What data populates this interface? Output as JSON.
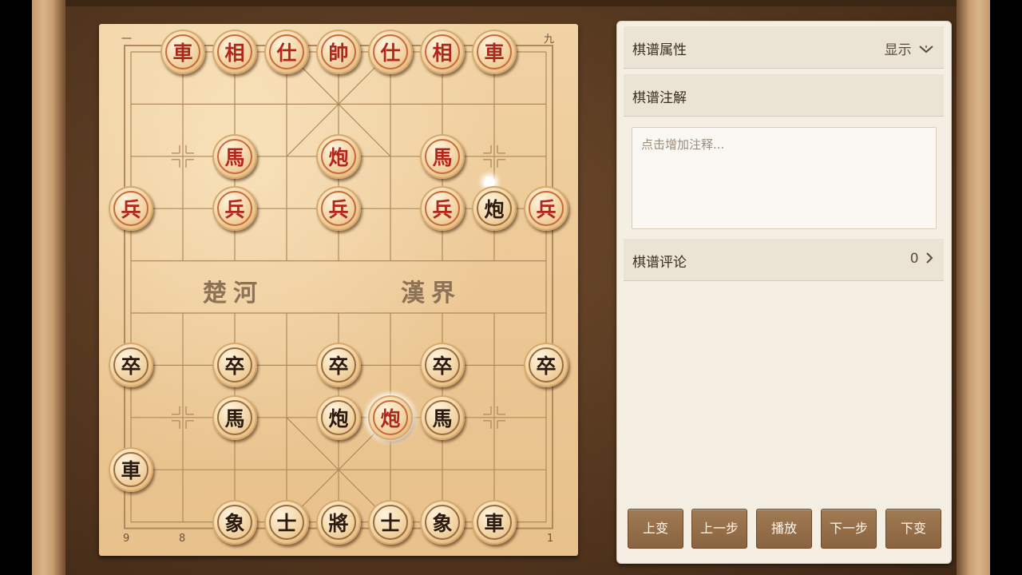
{
  "board": {
    "top_coords": [
      "一",
      "九"
    ],
    "bottom_coords": [
      "9",
      "8",
      "1"
    ],
    "river_left": "楚河",
    "river_right": "漢界"
  },
  "pieces": [
    {
      "id": "r-chariot-1",
      "side": "red",
      "char": "車",
      "col": 1,
      "row": 0
    },
    {
      "id": "r-elephant-1",
      "side": "red",
      "char": "相",
      "col": 2,
      "row": 0
    },
    {
      "id": "r-advisor-1",
      "side": "red",
      "char": "仕",
      "col": 3,
      "row": 0
    },
    {
      "id": "r-general",
      "side": "red",
      "char": "帥",
      "col": 4,
      "row": 0
    },
    {
      "id": "r-advisor-2",
      "side": "red",
      "char": "仕",
      "col": 5,
      "row": 0
    },
    {
      "id": "r-elephant-2",
      "side": "red",
      "char": "相",
      "col": 6,
      "row": 0
    },
    {
      "id": "r-chariot-2",
      "side": "red",
      "char": "車",
      "col": 7,
      "row": 0
    },
    {
      "id": "r-horse-1",
      "side": "red",
      "char": "馬",
      "col": 2,
      "row": 2
    },
    {
      "id": "r-cannon-1",
      "side": "red",
      "char": "炮",
      "col": 4,
      "row": 2
    },
    {
      "id": "r-horse-2",
      "side": "red",
      "char": "馬",
      "col": 6,
      "row": 2
    },
    {
      "id": "r-soldier-1",
      "side": "red",
      "char": "兵",
      "col": 0,
      "row": 3
    },
    {
      "id": "r-soldier-2",
      "side": "red",
      "char": "兵",
      "col": 2,
      "row": 3
    },
    {
      "id": "r-soldier-3",
      "side": "red",
      "char": "兵",
      "col": 4,
      "row": 3
    },
    {
      "id": "r-soldier-4",
      "side": "red",
      "char": "兵",
      "col": 6,
      "row": 3
    },
    {
      "id": "b-cannon-1",
      "side": "black",
      "char": "炮",
      "col": 7,
      "row": 3
    },
    {
      "id": "r-soldier-5",
      "side": "red",
      "char": "兵",
      "col": 8,
      "row": 3
    },
    {
      "id": "b-pawn-1",
      "side": "black",
      "char": "卒",
      "col": 0,
      "row": 6
    },
    {
      "id": "b-pawn-2",
      "side": "black",
      "char": "卒",
      "col": 2,
      "row": 6
    },
    {
      "id": "b-pawn-3",
      "side": "black",
      "char": "卒",
      "col": 4,
      "row": 6
    },
    {
      "id": "b-pawn-4",
      "side": "black",
      "char": "卒",
      "col": 6,
      "row": 6
    },
    {
      "id": "b-pawn-5",
      "side": "black",
      "char": "卒",
      "col": 8,
      "row": 6
    },
    {
      "id": "b-horse-1",
      "side": "black",
      "char": "馬",
      "col": 2,
      "row": 7
    },
    {
      "id": "b-cannon-2",
      "side": "black",
      "char": "炮",
      "col": 4,
      "row": 7
    },
    {
      "id": "r-cannon-2",
      "side": "red",
      "char": "炮",
      "col": 5,
      "row": 7,
      "selected": true
    },
    {
      "id": "b-horse-2",
      "side": "black",
      "char": "馬",
      "col": 6,
      "row": 7
    },
    {
      "id": "b-chariot-1",
      "side": "black",
      "char": "車",
      "col": 0,
      "row": 8
    },
    {
      "id": "b-elephant-1",
      "side": "black",
      "char": "象",
      "col": 2,
      "row": 9
    },
    {
      "id": "b-advisor-1",
      "side": "black",
      "char": "士",
      "col": 3,
      "row": 9
    },
    {
      "id": "b-general",
      "side": "black",
      "char": "將",
      "col": 4,
      "row": 9
    },
    {
      "id": "b-advisor-2",
      "side": "black",
      "char": "士",
      "col": 5,
      "row": 9
    },
    {
      "id": "b-elephant-2",
      "side": "black",
      "char": "象",
      "col": 6,
      "row": 9
    },
    {
      "id": "b-chariot-2",
      "side": "black",
      "char": "車",
      "col": 7,
      "row": 9
    }
  ],
  "panel": {
    "properties_label": "棋谱属性",
    "show_label": "显示",
    "annotation_label": "棋谱注解",
    "annotation_placeholder": "点击增加注释...",
    "comments_label": "棋谱评论",
    "comments_count": "0",
    "buttons": [
      "上变",
      "上一步",
      "播放",
      "下一步",
      "下变"
    ]
  }
}
